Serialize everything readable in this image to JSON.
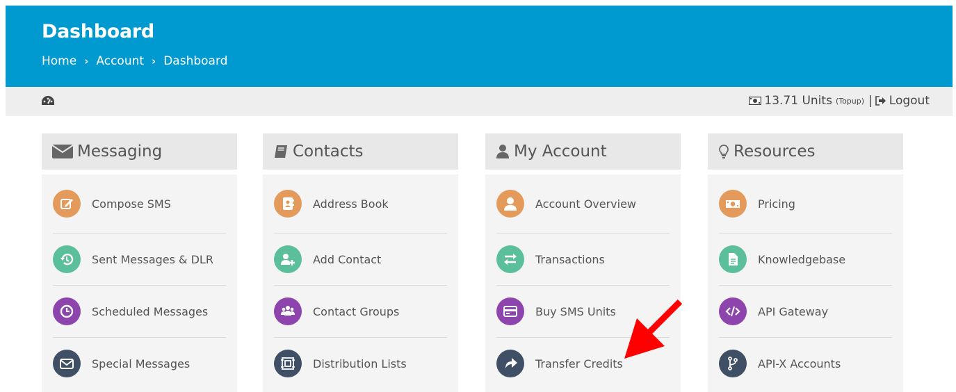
{
  "header": {
    "title": "Dashboard",
    "breadcrumb": [
      "Home",
      "Account",
      "Dashboard"
    ]
  },
  "infobar": {
    "dashboard_icon": "dashboard-gauge-icon",
    "balance_value": "13.71 Units",
    "balance_type": "(Topup)",
    "separator": "|",
    "logout_label": "Logout"
  },
  "colors": {
    "header_bg": "#0099d0",
    "orange": "#e49a5a",
    "teal": "#5cbf9b",
    "purple": "#8e44ad",
    "navy": "#3e4f66",
    "arrow": "#ff0000"
  },
  "cards": [
    {
      "title": "Messaging",
      "icon": "envelope-icon",
      "items": [
        {
          "label": "Compose SMS",
          "icon": "compose-icon",
          "color": "#e49a5a"
        },
        {
          "label": "Sent Messages & DLR",
          "icon": "history-icon",
          "color": "#5cbf9b"
        },
        {
          "label": "Scheduled Messages",
          "icon": "clock-icon",
          "color": "#8e44ad"
        },
        {
          "label": "Special Messages",
          "icon": "mail-icon",
          "color": "#3e4f66"
        }
      ]
    },
    {
      "title": "Contacts",
      "icon": "book-icon",
      "items": [
        {
          "label": "Address Book",
          "icon": "address-book-icon",
          "color": "#e49a5a"
        },
        {
          "label": "Add Contact",
          "icon": "add-user-icon",
          "color": "#5cbf9b"
        },
        {
          "label": "Contact Groups",
          "icon": "group-icon",
          "color": "#8e44ad"
        },
        {
          "label": "Distribution Lists",
          "icon": "distribution-icon",
          "color": "#3e4f66"
        }
      ]
    },
    {
      "title": "My Account",
      "icon": "user-icon",
      "items": [
        {
          "label": "Account Overview",
          "icon": "user-icon",
          "color": "#e49a5a"
        },
        {
          "label": "Transactions",
          "icon": "exchange-icon",
          "color": "#5cbf9b"
        },
        {
          "label": "Buy SMS Units",
          "icon": "credit-card-icon",
          "color": "#8e44ad"
        },
        {
          "label": "Transfer Credits",
          "icon": "share-arrow-icon",
          "color": "#3e4f66"
        }
      ]
    },
    {
      "title": "Resources",
      "icon": "lightbulb-icon",
      "items": [
        {
          "label": "Pricing",
          "icon": "money-icon",
          "color": "#e49a5a"
        },
        {
          "label": "Knowledgebase",
          "icon": "document-icon",
          "color": "#5cbf9b"
        },
        {
          "label": "API Gateway",
          "icon": "code-icon",
          "color": "#8e44ad"
        },
        {
          "label": "API-X Accounts",
          "icon": "branch-icon",
          "color": "#3e4f66"
        }
      ]
    }
  ],
  "annotation": {
    "icon": "red-pointer-arrow-icon"
  }
}
